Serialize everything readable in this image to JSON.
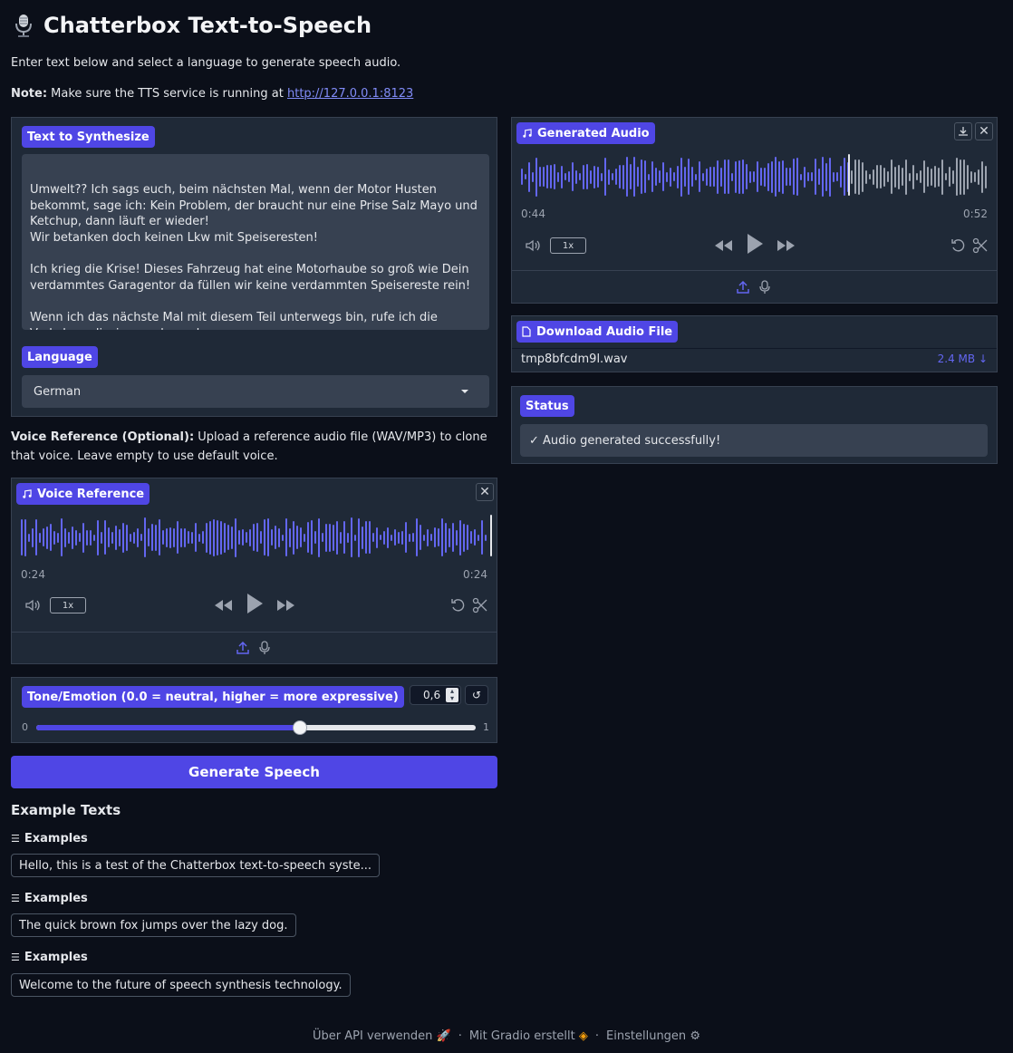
{
  "app": {
    "title": "Chatterbox Text-to-Speech",
    "intro": "Enter text below and select a language to generate speech audio.",
    "note_label": "Note:",
    "note_text": " Make sure the TTS service is running at ",
    "note_link": "http://127.0.0.1:8123"
  },
  "text_input": {
    "label": "Text to Synthesize",
    "value": "Umwelt?? Ich sags euch, beim nächsten Mal, wenn der Motor Husten bekommt, sage ich: Kein Problem, der braucht nur eine Prise Salz Mayo und Ketchup, dann läuft er wieder!\nWir betanken doch keinen Lkw mit Speiseresten!\n\nIch krieg die Krise! Dieses Fahrzeug hat eine Motorhaube so groß wie Dein verdammtes Garagentor da füllen wir keine verdammten Speisereste rein!\n\nWenn ich das nächste Mal mit diesem Teil unterwegs bin, rufe ich die Verkehrspolizei an und sag denen:"
  },
  "language": {
    "label": "Language",
    "selected": "German"
  },
  "voice_reference": {
    "desc_bold": "Voice Reference (Optional):",
    "desc_text": " Upload a reference audio file (WAV/MP3) to clone that voice. Leave empty to use default voice.",
    "label": "Voice Reference",
    "time_current": "0:24",
    "time_total": "0:24",
    "speed": "1x",
    "progress": 1.0
  },
  "tone": {
    "label": "Tone/Emotion (0.0 = neutral, higher = more expressive)",
    "value": "0,6",
    "value_num": 0.6,
    "min_label": "0",
    "max_label": "1",
    "reset": "↺"
  },
  "generate_button": "Generate Speech",
  "examples": {
    "title": "Example Texts",
    "items": [
      {
        "label": "Examples",
        "text": "Hello, this is a test of the Chatterbox text-to-speech syste..."
      },
      {
        "label": "Examples",
        "text": "The quick brown fox jumps over the lazy dog."
      },
      {
        "label": "Examples",
        "text": "Welcome to the future of speech synthesis technology."
      }
    ]
  },
  "generated_audio": {
    "label": "Generated Audio",
    "time_current": "0:44",
    "time_total": "0:52",
    "speed": "1x",
    "progress": 0.7
  },
  "download": {
    "label": "Download Audio File",
    "filename": "tmp8bfcdm9l.wav",
    "size": "2.4 MB ↓"
  },
  "status": {
    "label": "Status",
    "message": "✓ Audio generated successfully!"
  },
  "footer": {
    "api": "Über API verwenden",
    "gradio": "Mit Gradio erstellt",
    "settings": "Einstellungen",
    "sep": "·"
  },
  "colors": {
    "accent": "#4f46e5",
    "wave_played": "#6366f1",
    "wave_unplayed": "#9ca3af",
    "background": "#0b0f19"
  }
}
